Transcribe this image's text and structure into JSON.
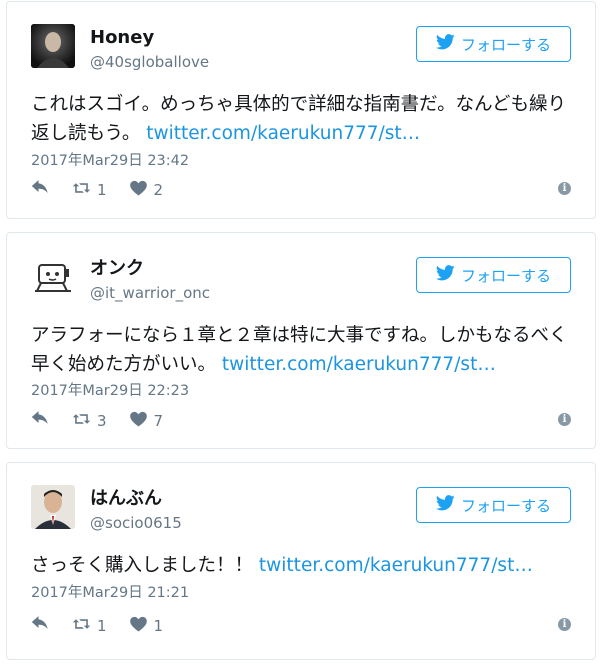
{
  "tweets": [
    {
      "name": "Honey",
      "handle": "@40sgloballove",
      "follow_label": "フォローする",
      "text_before": "これはスゴイ。めっちゃ具体的で詳細な指南書だ。なんども繰り返し読もう。",
      "link": "twitter.com/kaerukun777/st…",
      "timestamp": "2017年Mar29日 23:42",
      "retweets": "1",
      "likes": "2"
    },
    {
      "name": "オンク",
      "handle": "@it_warrior_onc",
      "follow_label": "フォローする",
      "text_before": "アラフォーになら１章と２章は特に大事ですね。しかもなるべく早く始めた方がいい。",
      "link": "twitter.com/kaerukun777/st…",
      "timestamp": "2017年Mar29日 22:23",
      "retweets": "3",
      "likes": "7"
    },
    {
      "name": "はんぶん",
      "handle": "@socio0615",
      "follow_label": "フォローする",
      "text_before": "さっそく購入しました！！",
      "link": "twitter.com/kaerukun777/st…",
      "timestamp": "2017年Mar29日 21:21",
      "retweets": "1",
      "likes": "1"
    }
  ],
  "colors": {
    "accent": "#1da1f2",
    "link": "#1b95e0",
    "muted": "#657786",
    "border": "#e1e8ed"
  },
  "icons": [
    "twitter-bird-icon",
    "reply-icon",
    "retweet-icon",
    "heart-icon",
    "info-icon"
  ]
}
